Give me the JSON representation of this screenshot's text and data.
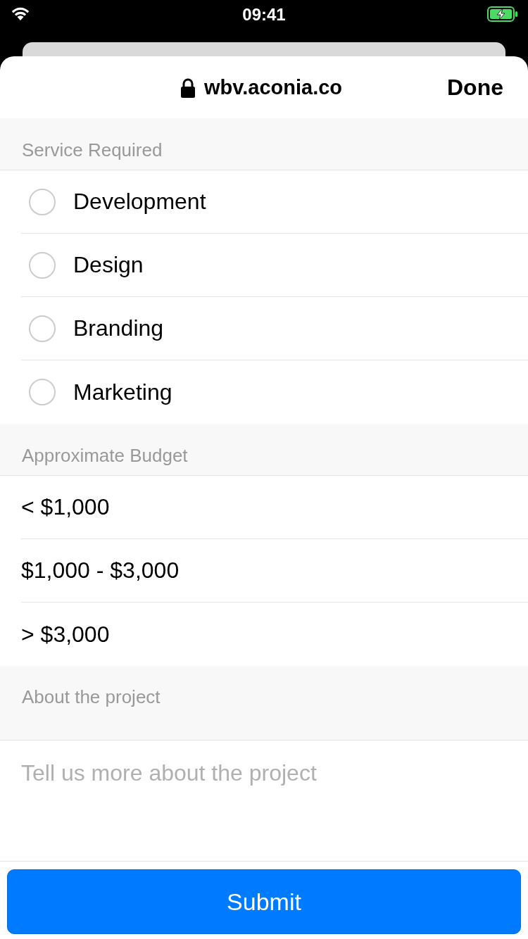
{
  "status_bar": {
    "time": "09:41"
  },
  "header": {
    "url": "wbv.aconia.co",
    "done": "Done"
  },
  "sections": [
    {
      "title": "Service Required",
      "kind": "radio",
      "options": [
        {
          "label": "Development",
          "selected": false
        },
        {
          "label": "Design",
          "selected": false
        },
        {
          "label": "Branding",
          "selected": false
        },
        {
          "label": "Marketing",
          "selected": false
        }
      ]
    },
    {
      "title": "Approximate Budget",
      "kind": "list",
      "options": [
        {
          "label": "< $1,000",
          "selected": false
        },
        {
          "label": "$1,000 - $3,000",
          "selected": false
        },
        {
          "label": "> $3,000",
          "selected": false
        }
      ]
    },
    {
      "title": "About the project",
      "kind": "text",
      "placeholder": "Tell us more about the project"
    }
  ],
  "submit": "Submit"
}
